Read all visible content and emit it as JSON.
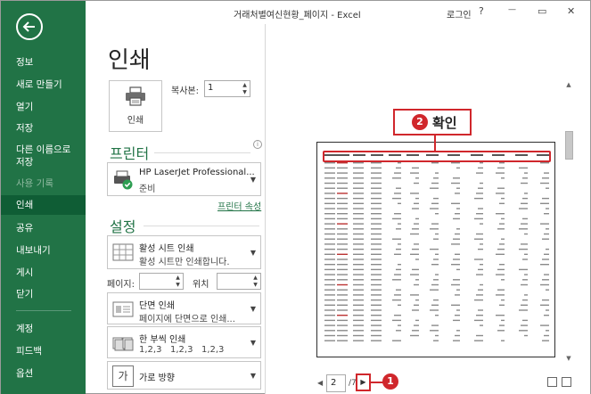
{
  "window": {
    "title": "거래처별여신현황_페이지 - Excel",
    "login": "로그인",
    "help": "?",
    "minimize": "—",
    "restore": "▭",
    "close": "✕"
  },
  "sidebar": {
    "items": [
      {
        "label": "정보"
      },
      {
        "label": "새로 만들기"
      },
      {
        "label": "열기"
      },
      {
        "label": "저장"
      },
      {
        "label": "다른 이름으로 저장"
      },
      {
        "label": "사용 기록"
      },
      {
        "label": "인쇄"
      },
      {
        "label": "공유"
      },
      {
        "label": "내보내기"
      },
      {
        "label": "게시"
      },
      {
        "label": "닫기"
      },
      {
        "label": "계정"
      },
      {
        "label": "피드백"
      },
      {
        "label": "옵션"
      }
    ]
  },
  "print": {
    "heading": "인쇄",
    "button_label": "인쇄",
    "copies_label": "복사본:",
    "copies_value": "1"
  },
  "printer": {
    "heading": "프린터",
    "name": "HP LaserJet Professional...",
    "status": "준비",
    "properties_link": "프린터 속성"
  },
  "settings": {
    "heading": "설정",
    "scope_title": "활성 시트 인쇄",
    "scope_desc": "활성 시트만 인쇄합니다.",
    "pages_label": "페이지:",
    "to_label": "위치",
    "sides_title": "단면 인쇄",
    "sides_desc": "페이지에 단면으로 인쇄...",
    "collate_title": "한 부씩 인쇄",
    "collate_desc": "1,2,3   1,2,3   1,2,3",
    "orientation_title": "가로 방향",
    "orientation_icon_text": "가"
  },
  "preview": {
    "callout_number": "2",
    "callout_text": "확인",
    "current_page": "2",
    "total_pages": "/7",
    "next_badge": "1"
  },
  "colors": {
    "excel_green": "#217346",
    "annotation_red": "#d0272c"
  }
}
